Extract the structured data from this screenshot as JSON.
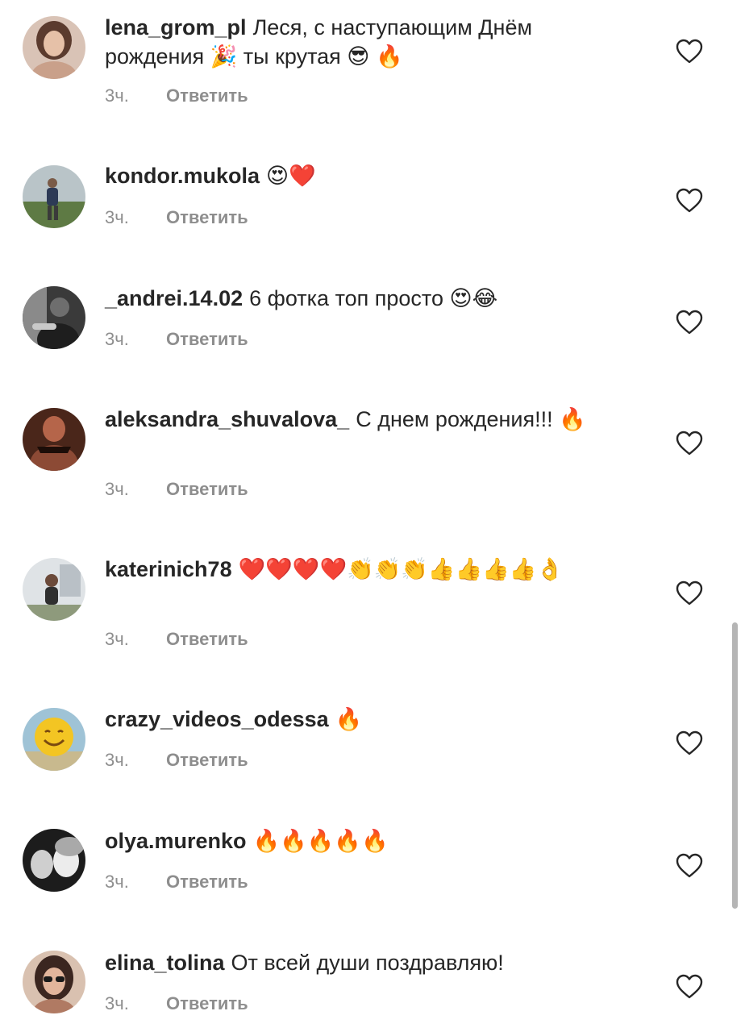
{
  "comments": [
    {
      "username": "lena_grom_pl",
      "text": "Леся, с наступающим  Днём рождения 🎉 ты крутая 😎 🔥",
      "time": "3ч.",
      "reply": "Ответить",
      "avatar_icon": "avatar-woman-brown-hair",
      "avatar_colors": [
        "#c9a08a",
        "#5b3b2e"
      ]
    },
    {
      "username": "kondor.mukola",
      "text": "😍❤️",
      "time": "3ч.",
      "reply": "Ответить",
      "avatar_icon": "avatar-man-in-field",
      "avatar_colors": [
        "#a9b4b7",
        "#4f6a3a"
      ]
    },
    {
      "username": "_andrei.14.02",
      "text": "6 фотка топ просто 😍😂",
      "time": "3ч.",
      "reply": "Ответить",
      "avatar_icon": "avatar-man-bw",
      "avatar_colors": [
        "#2b2b2b",
        "#8a8a8a"
      ]
    },
    {
      "username": "aleksandra_shuvalova_",
      "text": "С днем рождения!!! 🔥",
      "time": "3ч.",
      "reply": "Ответить",
      "avatar_icon": "avatar-woman-dark",
      "avatar_colors": [
        "#3a1d14",
        "#b5654a"
      ]
    },
    {
      "username": "katerinich78",
      "text": "❤️❤️❤️❤️👏👏👏👍👍👍👍👌",
      "time": "3ч.",
      "reply": "Ответить",
      "avatar_icon": "avatar-woman-outdoor",
      "avatar_colors": [
        "#c9cfd3",
        "#3d3d3d"
      ]
    },
    {
      "username": "crazy_videos_odessa",
      "text": "🔥",
      "time": "3ч.",
      "reply": "Ответить",
      "avatar_icon": "avatar-smiley-yellow",
      "avatar_colors": [
        "#9fc3d6",
        "#f3c523"
      ]
    },
    {
      "username": "olya.murenko",
      "text": "🔥🔥🔥🔥🔥",
      "time": "3ч.",
      "reply": "Ответить",
      "avatar_icon": "avatar-two-faces-bw",
      "avatar_colors": [
        "#1c1c1c",
        "#e4e4e4"
      ]
    },
    {
      "username": "elina_tolina",
      "text": "От всей души поздравляю!",
      "time": "3ч.",
      "reply": "Ответить",
      "avatar_icon": "avatar-woman-sunglasses",
      "avatar_colors": [
        "#b07a63",
        "#3b2620"
      ]
    }
  ],
  "colors": {
    "text": "#262626",
    "secondary": "#8e8e8e",
    "scrollbar": "#b5b5b5"
  },
  "like_icon": "heart-outline-icon"
}
